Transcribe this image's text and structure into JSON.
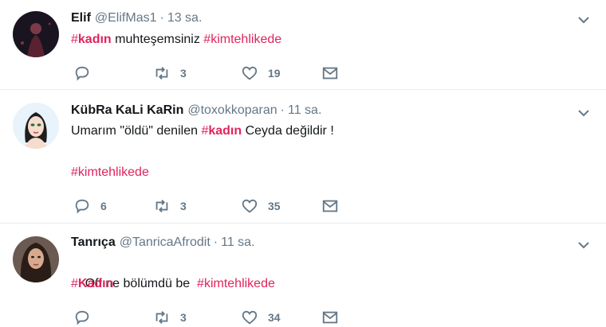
{
  "tweets": [
    {
      "name": "Elif",
      "handle": "@ElifMas1",
      "time": "13 sa.",
      "body": [
        {
          "type": "tag",
          "hash": "#",
          "word": "kadın",
          "bold": true
        },
        {
          "type": "text",
          "value": " muhteşemsiniz "
        },
        {
          "type": "tag",
          "hash": "#",
          "word": "kimtehlikede",
          "bold": false
        }
      ],
      "line2": [],
      "reply_count": "",
      "retweet_count": "3",
      "like_count": "19"
    },
    {
      "name": "KübRa KaLi KaRin",
      "handle": "@toxokkoparan",
      "time": "11 sa.",
      "body": [
        {
          "type": "text",
          "value": "Umarım \"öldü\" denilen "
        },
        {
          "type": "tag",
          "hash": "#",
          "word": "kadın",
          "bold": true
        },
        {
          "type": "text",
          "value": " Ceyda değildir !"
        }
      ],
      "line2": [
        {
          "type": "tag",
          "hash": "#",
          "word": "kimtehlikede",
          "bold": false
        }
      ],
      "reply_count": "6",
      "retweet_count": "3",
      "like_count": "35"
    },
    {
      "name": "Tanrıça",
      "handle": "@TanricaAfrodit",
      "time": "11 sa.",
      "body": [
        {
          "type": "text",
          "value": "Off ne bölümdü be  "
        },
        {
          "type": "tag",
          "hash": "#",
          "word": "kimtehlikede",
          "bold": false
        }
      ],
      "line2": [
        {
          "type": "tag",
          "hash": "#",
          "word": "Kadın",
          "bold": true
        }
      ],
      "reply_count": "",
      "retweet_count": "3",
      "like_count": "34"
    }
  ],
  "separator": "·",
  "colors": {
    "hashtag": "#e0245e",
    "muted": "#657786",
    "divider": "#e6ecf0"
  },
  "icons": [
    "reply-icon",
    "retweet-icon",
    "like-icon",
    "direct-message-icon",
    "chevron-down-icon"
  ]
}
